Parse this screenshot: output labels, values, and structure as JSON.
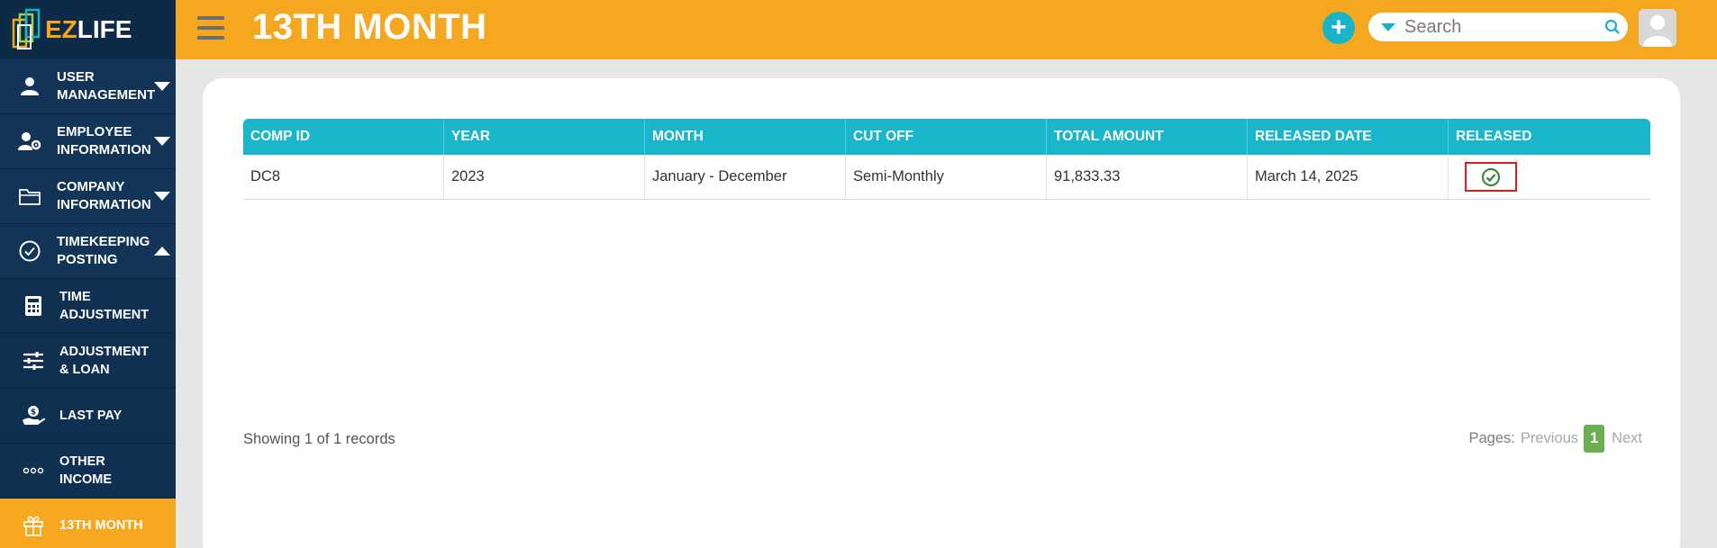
{
  "brand": {
    "logo_ez": "EZ",
    "logo_life": "LIFE"
  },
  "sidebar": {
    "items": [
      {
        "label": "USER MANAGEMENT",
        "icon": "user-icon",
        "expanded": false
      },
      {
        "label": "EMPLOYEE INFORMATION",
        "icon": "user-gear-icon",
        "expanded": false
      },
      {
        "label": "COMPANY INFORMATION",
        "icon": "folder-icon",
        "expanded": false
      },
      {
        "label": "TIMEKEEPING POSTING",
        "icon": "check-circle-icon",
        "expanded": true
      }
    ],
    "subitems": [
      {
        "label": "TIME ADJUSTMENT",
        "icon": "calculator-icon"
      },
      {
        "label": "ADJUSTMENT & LOAN",
        "icon": "sliders-icon"
      },
      {
        "label": "LAST PAY",
        "icon": "hand-money-icon"
      },
      {
        "label": "OTHER INCOME",
        "icon": "dots-icon"
      },
      {
        "label": "13TH MONTH",
        "icon": "gift-icon",
        "active": true
      }
    ]
  },
  "header": {
    "title": "13TH MONTH",
    "add_symbol": "+",
    "search_placeholder": "Search"
  },
  "table": {
    "columns": [
      "COMP ID",
      "YEAR",
      "MONTH",
      "CUT OFF",
      "TOTAL AMOUNT",
      "RELEASED DATE",
      "RELEASED"
    ],
    "rows": [
      {
        "comp_id": "DC8",
        "year": "2023",
        "month": "January - December",
        "cut_off": "Semi-Monthly",
        "total_amount": "91,833.33",
        "released_date": "March 14, 2025",
        "released": true
      }
    ]
  },
  "footer": {
    "showing": "Showing 1 of 1 records",
    "pages_label": "Pages:",
    "previous": "Previous",
    "current_page": "1",
    "next": "Next"
  },
  "colors": {
    "header_bg": "#f5a81f",
    "sidebar_bg": "#0f2c4a",
    "table_header_bg": "#1ab6cb",
    "check_green": "#3a8a3a",
    "highlight_red": "#d42020",
    "page_active": "#6cae52"
  }
}
